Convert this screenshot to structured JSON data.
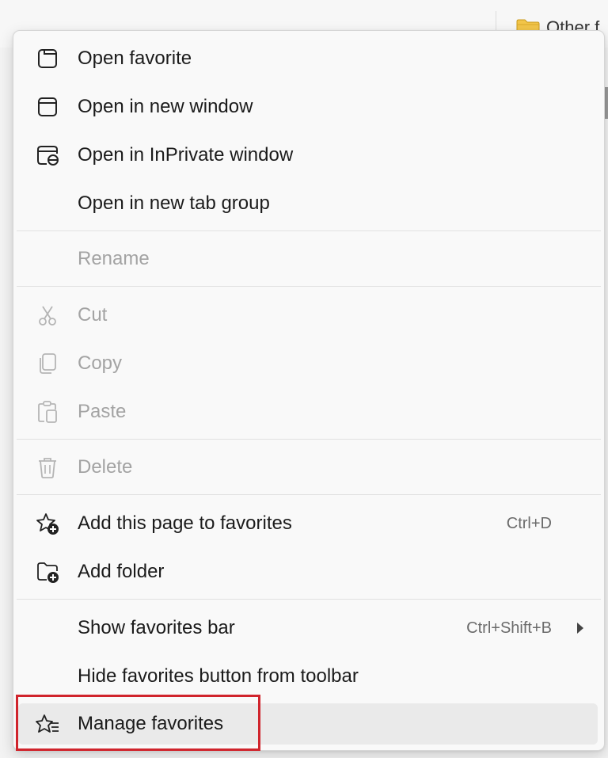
{
  "background": {
    "bar_folder_label": "Other f"
  },
  "menu": {
    "open_favorite": "Open favorite",
    "open_new_window": "Open in new window",
    "open_inprivate": "Open in InPrivate window",
    "open_tab_group": "Open in new tab group",
    "rename": "Rename",
    "cut": "Cut",
    "copy": "Copy",
    "paste": "Paste",
    "delete": "Delete",
    "add_page": "Add this page to favorites",
    "add_page_shortcut": "Ctrl+D",
    "add_folder": "Add folder",
    "show_bar": "Show favorites bar",
    "show_bar_shortcut": "Ctrl+Shift+B",
    "hide_button": "Hide favorites button from toolbar",
    "manage": "Manage favorites"
  },
  "colors": {
    "highlight_border": "#d0242c",
    "disabled_text": "#a3a3a3",
    "folder": "#f3c64a"
  }
}
